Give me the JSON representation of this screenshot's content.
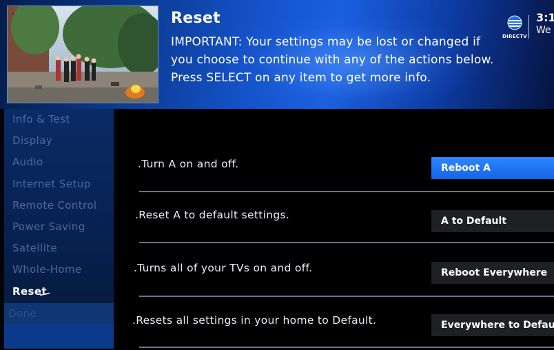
{
  "header": {
    "title": "Reset",
    "description": "IMPORTANT: Your settings may be lost or changed if you choose to continue with any of the actions below. Press SELECT on any item to get more info.",
    "brand": "DIRECTV",
    "time": "3:1",
    "date": "We"
  },
  "sidebar": {
    "items": [
      {
        "label": "Info & Test"
      },
      {
        "label": "Display"
      },
      {
        "label": "Audio"
      },
      {
        "label": "Internet Setup"
      },
      {
        "label": "Remote Control"
      },
      {
        "label": "Power Saving"
      },
      {
        "label": "Satellite"
      },
      {
        "label": "Whole-Home"
      },
      {
        "label": "Reset"
      },
      {
        "label": "Done"
      }
    ]
  },
  "options": [
    {
      "description": ".Turn A on and off.",
      "button": "Reboot A"
    },
    {
      "description": ".Reset A to default settings.",
      "button": "A to Default"
    },
    {
      "description": ".Turns all of your TVs on and off.",
      "button": "Reboot Everywhere"
    },
    {
      "description": ".Resets all settings in your home to Default.",
      "button": "Everywhere to Default"
    }
  ],
  "colors": {
    "header_blue": "#1552c8",
    "focus_blue": "#1e6df5",
    "sidebar_bg": "#07214f",
    "button_bg": "#1e2024"
  }
}
